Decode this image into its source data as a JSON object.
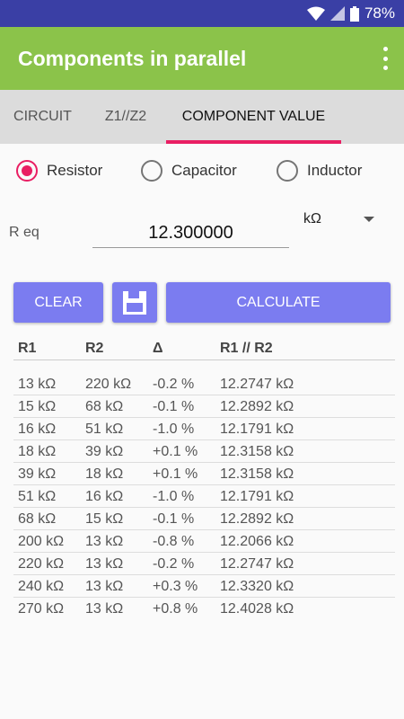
{
  "status": {
    "battery": "78%"
  },
  "app": {
    "title": "Components in parallel"
  },
  "tabs": [
    {
      "label": "CIRCUIT"
    },
    {
      "label": "Z1//Z2"
    },
    {
      "label": "COMPONENT VALUE"
    }
  ],
  "radios": [
    {
      "label": "Resistor",
      "checked": true
    },
    {
      "label": "Capacitor",
      "checked": false
    },
    {
      "label": "Inductor",
      "checked": false
    }
  ],
  "req": {
    "label": "R eq",
    "value": "12.300000",
    "unit": "kΩ"
  },
  "buttons": {
    "clear": "CLEAR",
    "calculate": "CALCULATE"
  },
  "table": {
    "headers": [
      "R1",
      "R2",
      "Δ",
      "R1 // R2"
    ],
    "rows": [
      [
        "13 kΩ",
        "220 kΩ",
        "-0.2 %",
        "12.2747 kΩ"
      ],
      [
        "15 kΩ",
        "68 kΩ",
        "-0.1 %",
        "12.2892 kΩ"
      ],
      [
        "16 kΩ",
        "51 kΩ",
        "-1.0 %",
        "12.1791 kΩ"
      ],
      [
        "18 kΩ",
        "39 kΩ",
        "+0.1 %",
        "12.3158 kΩ"
      ],
      [
        "39 kΩ",
        "18 kΩ",
        "+0.1 %",
        "12.3158 kΩ"
      ],
      [
        "51 kΩ",
        "16 kΩ",
        "-1.0 %",
        "12.1791 kΩ"
      ],
      [
        "68 kΩ",
        "15 kΩ",
        "-0.1 %",
        "12.2892 kΩ"
      ],
      [
        "200 kΩ",
        "13 kΩ",
        "-0.8 %",
        "12.2066 kΩ"
      ],
      [
        "220 kΩ",
        "13 kΩ",
        "-0.2 %",
        "12.2747 kΩ"
      ],
      [
        "240 kΩ",
        "13 kΩ",
        "+0.3 %",
        "12.3320 kΩ"
      ],
      [
        "270 kΩ",
        "13 kΩ",
        "+0.8 %",
        "12.4028 kΩ"
      ]
    ]
  },
  "colors": {
    "status_bar": "#3a3fa5",
    "app_bar": "#8bc34a",
    "accent": "#e91e63",
    "button": "#7b7cf0"
  }
}
